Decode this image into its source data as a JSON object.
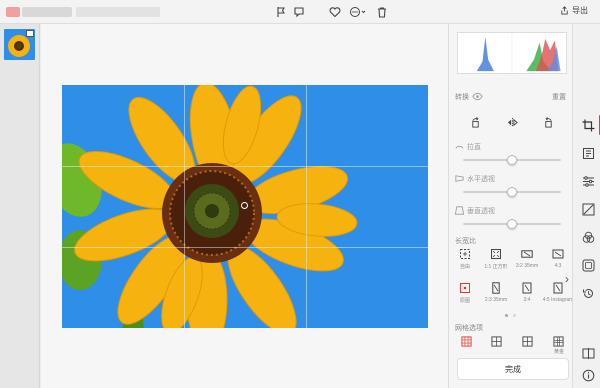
{
  "titlebar": {
    "icons": [
      "flag-icon",
      "annotate-icon",
      "heart-icon",
      "more-icon",
      "trash-icon"
    ],
    "export_label": "导出"
  },
  "canvas": {
    "photo_subject": "sunflower"
  },
  "panel": {
    "transform_label": "转换",
    "reset_label": "重置",
    "sliders": [
      {
        "label": "拉直",
        "value": 0.5
      },
      {
        "label": "水平透视",
        "value": 0.5
      },
      {
        "label": "垂直透视",
        "value": 0.5
      }
    ],
    "ratio_label": "长宽比",
    "ratios": [
      {
        "label": "自由",
        "icon": "free-crop-icon"
      },
      {
        "label": "1:1 正方形",
        "icon": "square-icon"
      },
      {
        "label": "3:2 35mm",
        "icon": "ratio-3-2-icon"
      },
      {
        "label": "4:3",
        "icon": "ratio-4-3-icon"
      },
      {
        "label": "原图",
        "icon": "original-icon"
      },
      {
        "label": "2:3 35mm",
        "icon": "ratio-2-3-icon"
      },
      {
        "label": "3:4",
        "icon": "ratio-3-4-icon"
      },
      {
        "label": "4:5 Instagram",
        "icon": "ratio-4-5-icon"
      }
    ],
    "grid_label": "网格选项",
    "grid_partial_label": "黄金",
    "done_label": "完成"
  },
  "colors": {
    "accent": "#e53935",
    "sky": "#2f8ee8",
    "petal": "#f6b20f",
    "center": "#5a2a0e"
  }
}
